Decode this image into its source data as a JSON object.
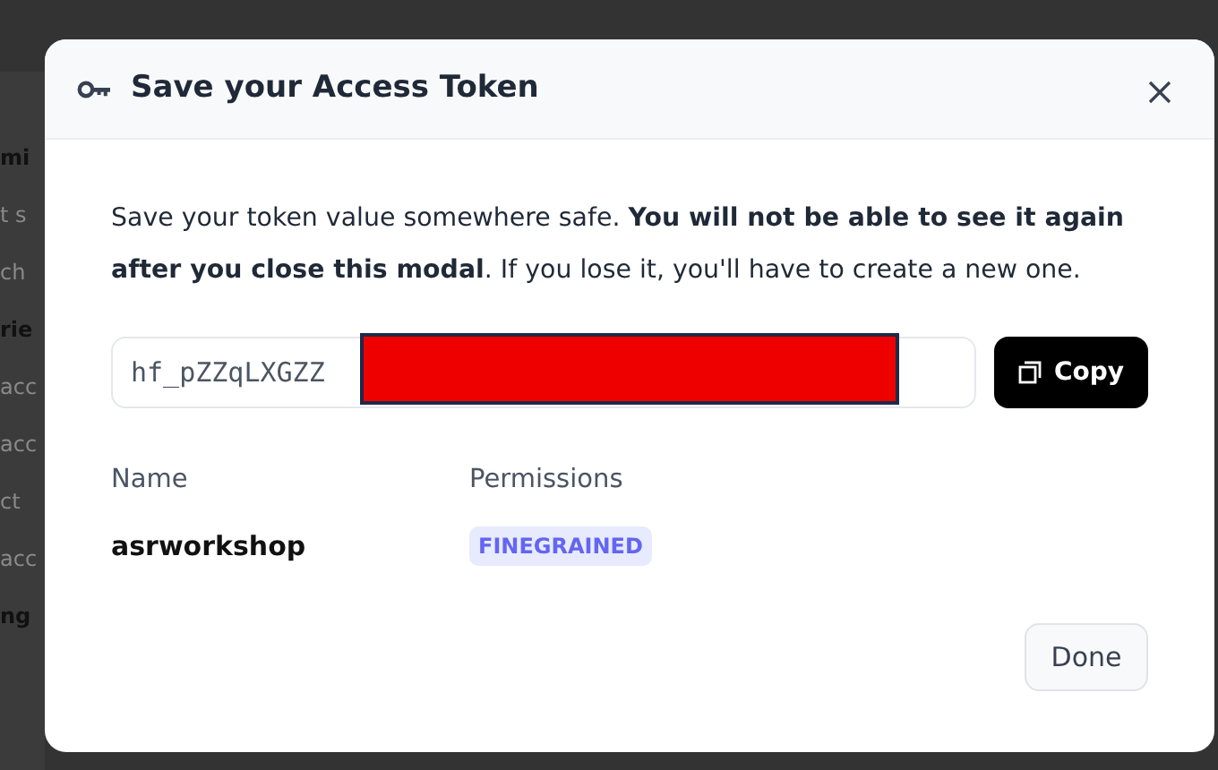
{
  "background_fragments": [
    {
      "text": "mi",
      "bold": true
    },
    {
      "text": "t s",
      "bold": false
    },
    {
      "text": "ch",
      "bold": false
    },
    {
      "text": "rie",
      "bold": true
    },
    {
      "text": "acc",
      "bold": false
    },
    {
      "text": "acc",
      "bold": false
    },
    {
      "text": "ct",
      "bold": false
    },
    {
      "text": "acc",
      "bold": false
    },
    {
      "text": "ng",
      "bold": true
    }
  ],
  "modal": {
    "title": "Save your Access Token",
    "message": "Save your token value somewhere safe. **You will not be able to see it again after you close this modal**. If you lose it, you'll have to create a new one.",
    "token": {
      "value": "hf_pZZqLXGZZ",
      "redacted": true
    },
    "copy_button": "Copy",
    "columns": [
      "Name",
      "Permissions"
    ],
    "token_name": "asrworkshop",
    "permission_badge": "FINEGRAINED",
    "done_button": "Done"
  }
}
